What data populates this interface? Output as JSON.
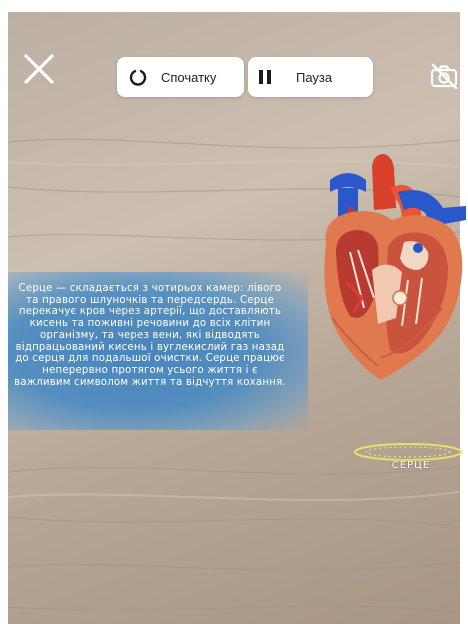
{
  "toolbar": {
    "restart_label": "Спочатку",
    "pause_label": "Пауза"
  },
  "icons": {
    "close": "close-icon",
    "restart": "restart-icon",
    "pause": "pause-icon",
    "camera_off": "camera-off-icon"
  },
  "info": {
    "text": "Серце — складається з чотирьох камер: лівого та правого шлуночків та передсердь. Серце перекачує кров через артерії, що доставляють кисень та поживні речовини до всіх клітин організму, та через вени, які відводять відпрацьований кисень і вуглекислий газ назад до серця для подальшої очистки. Серце працює неперервно протягом усього життя і є важливим символом життя та відчуття кохання."
  },
  "model": {
    "label": "СЕРЦЕ"
  },
  "colors": {
    "panel": "#4a8bc4",
    "label_ring": "#e8e06a",
    "artery_red": "#d9402a",
    "vein_blue": "#2a57c9"
  }
}
